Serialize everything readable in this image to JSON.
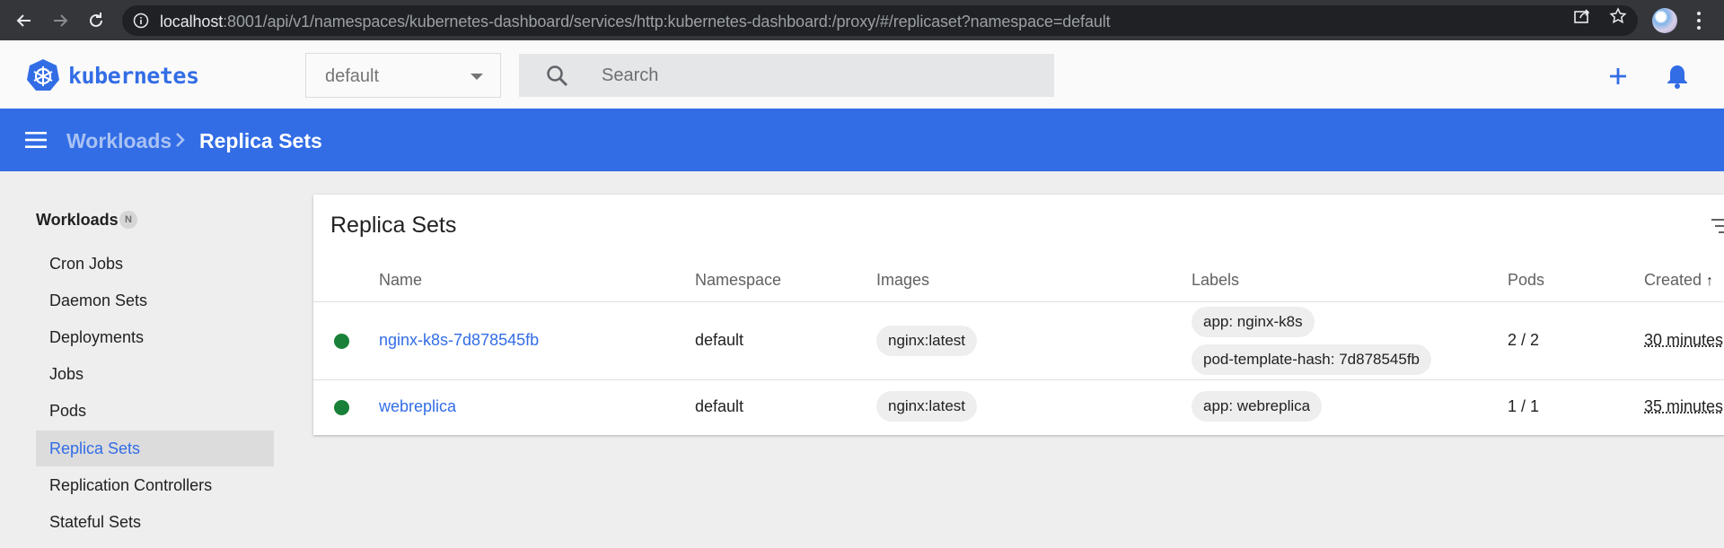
{
  "browser": {
    "url_host": "localhost",
    "url_rest": ":8001/api/v1/namespaces/kubernetes-dashboard/services/http:kubernetes-dashboard:/proxy/#/replicaset?namespace=default"
  },
  "header": {
    "logo_text": "kubernetes",
    "namespace_selected": "default",
    "search_placeholder": "Search"
  },
  "breadcrumb": {
    "parent": "Workloads",
    "current": "Replica Sets"
  },
  "sidebar": {
    "heading": "Workloads",
    "badge": "N",
    "items": [
      {
        "label": "Cron Jobs"
      },
      {
        "label": "Daemon Sets"
      },
      {
        "label": "Deployments"
      },
      {
        "label": "Jobs"
      },
      {
        "label": "Pods"
      },
      {
        "label": "Replica Sets",
        "active": true
      },
      {
        "label": "Replication Controllers"
      },
      {
        "label": "Stateful Sets"
      }
    ]
  },
  "card": {
    "title": "Replica Sets",
    "columns": [
      "Name",
      "Namespace",
      "Images",
      "Labels",
      "Pods",
      "Created"
    ],
    "rows": [
      {
        "name": "nginx-k8s-7d878545fb",
        "namespace": "default",
        "image": "nginx:latest",
        "labels": [
          "app: nginx-k8s",
          "pod-template-hash: 7d878545fb"
        ],
        "pods": "2 / 2",
        "created": "30 minutes"
      },
      {
        "name": "webreplica",
        "namespace": "default",
        "image": "nginx:latest",
        "labels": [
          "app: webreplica"
        ],
        "pods": "1 / 1",
        "created": "35 minutes"
      }
    ]
  },
  "colors": {
    "brand": "#326de6",
    "status_ok": "#188038"
  }
}
